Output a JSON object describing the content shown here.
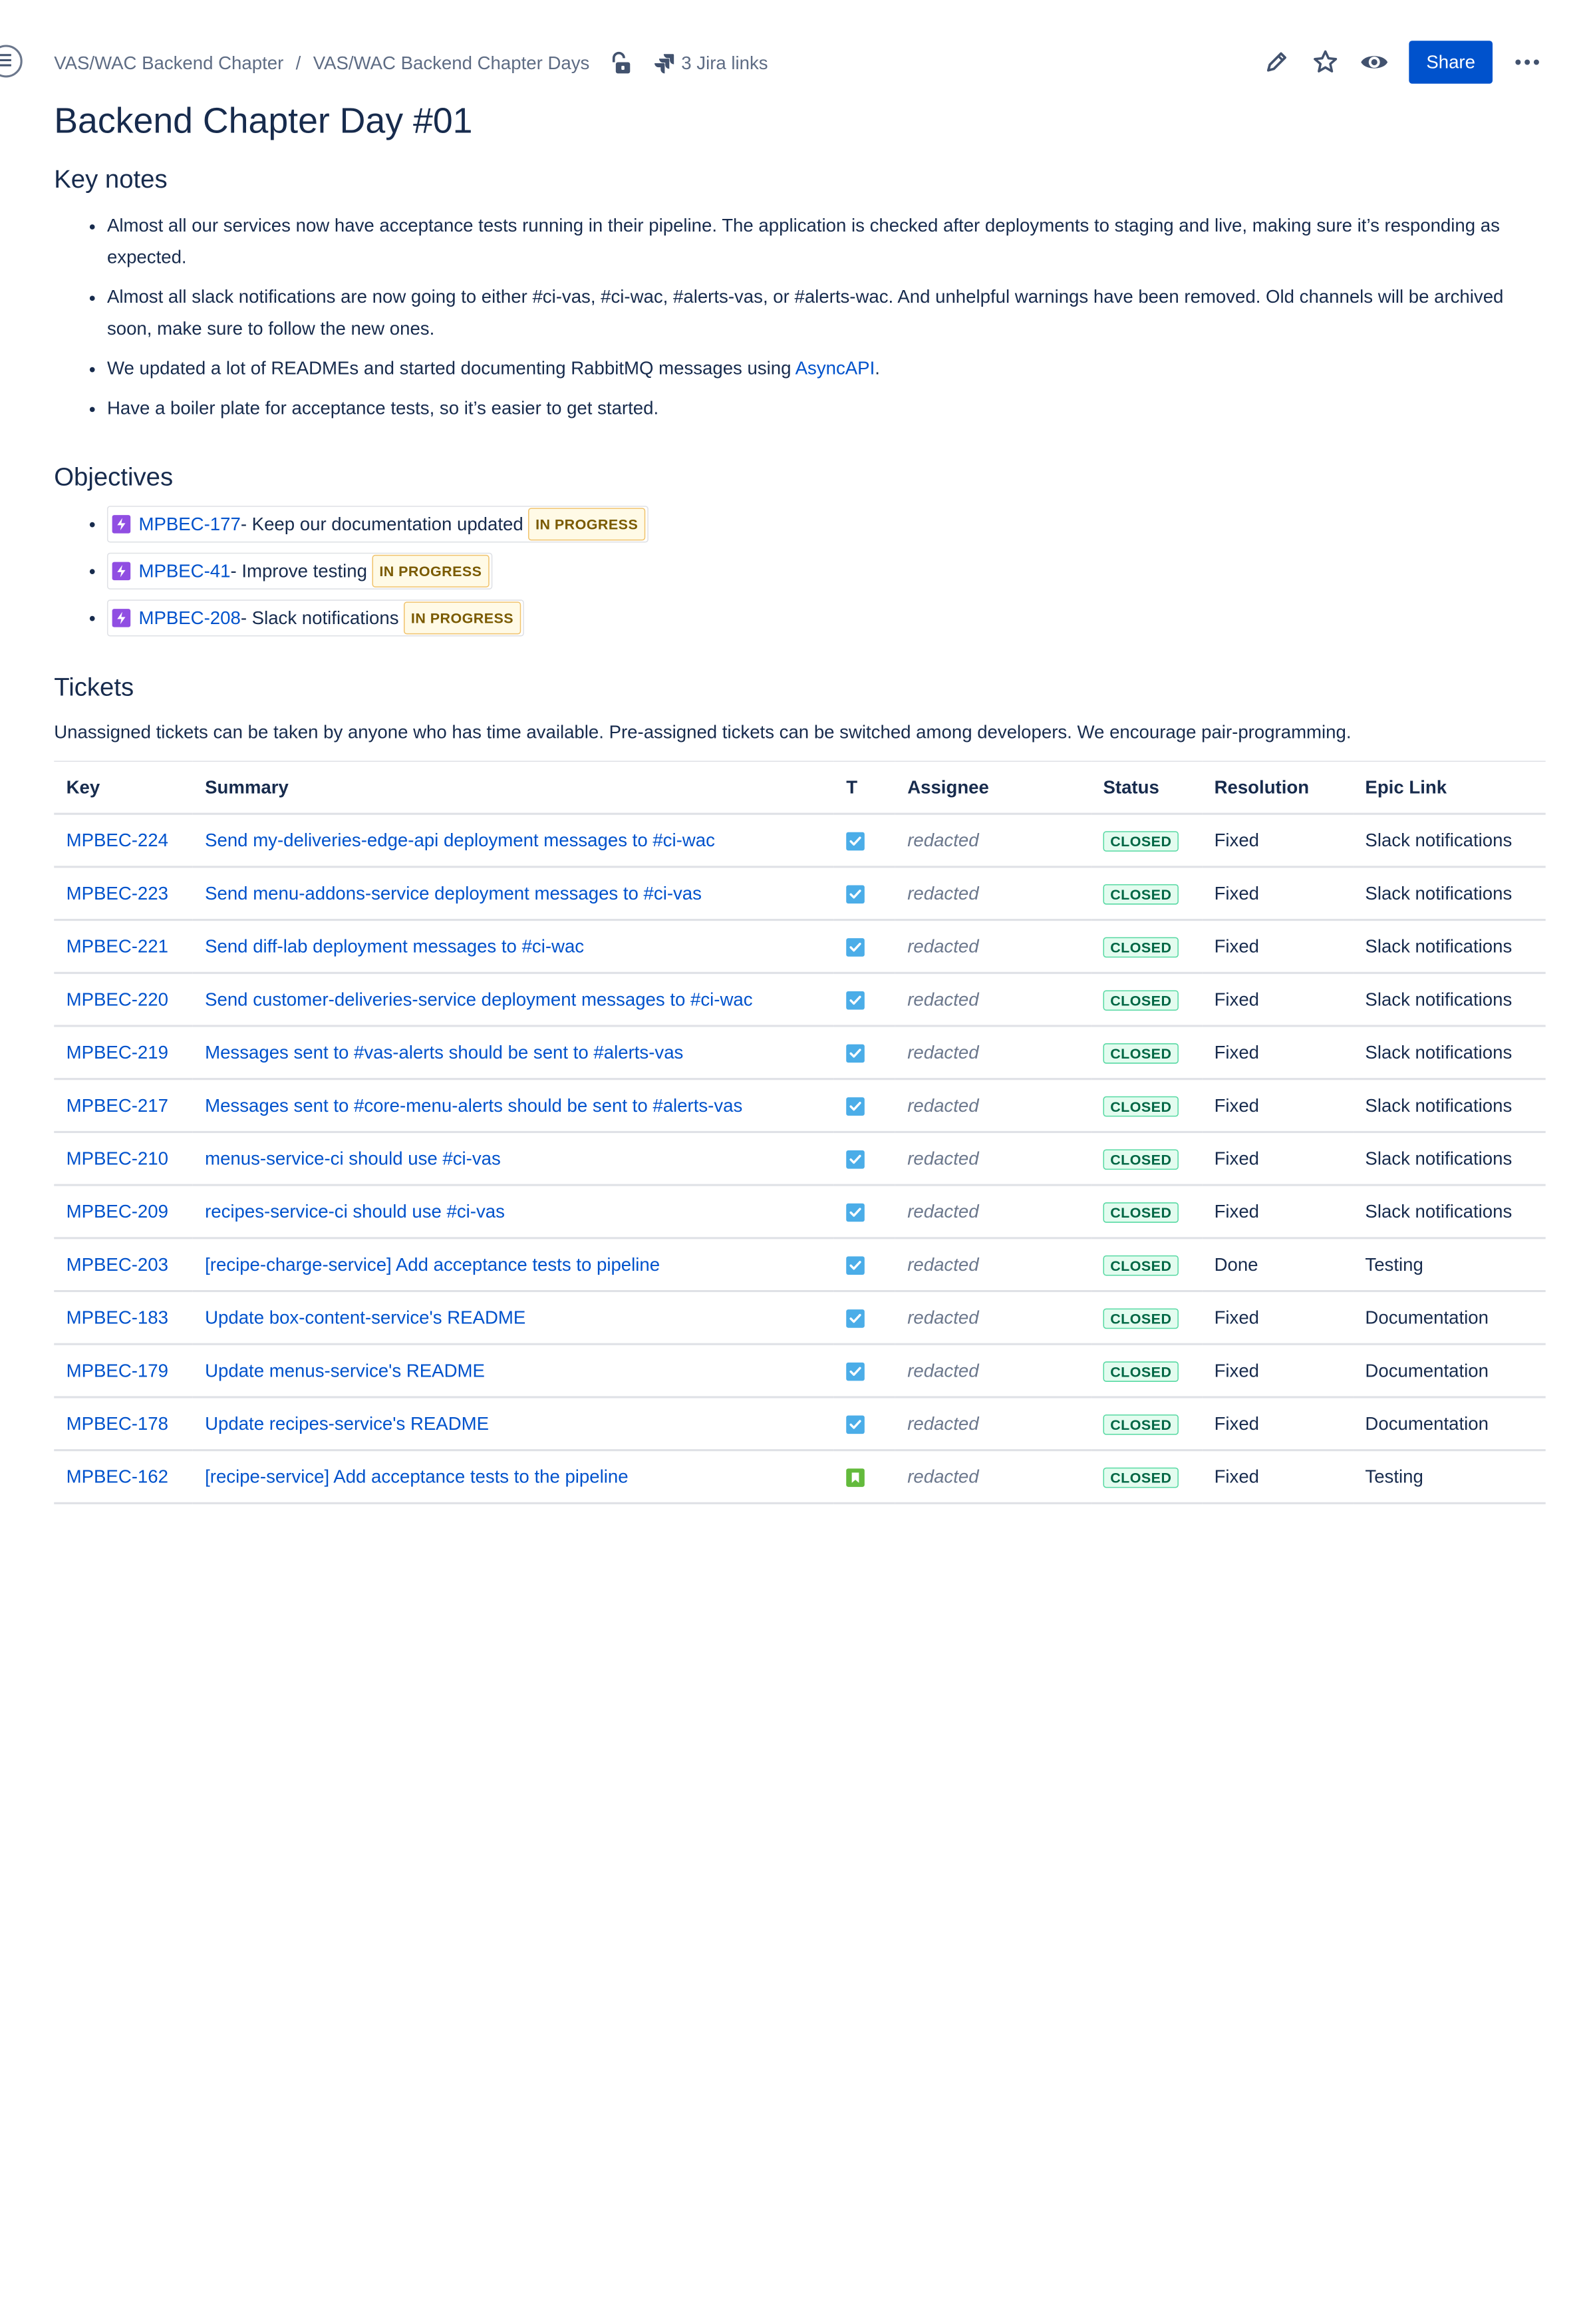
{
  "breadcrumbs": [
    "VAS/WAC Backend Chapter",
    "VAS/WAC Backend Chapter Days"
  ],
  "breadcrumb_separator": "/",
  "jira_links_label": "3 Jira links",
  "share_label": "Share",
  "title": "Backend Chapter Day #01",
  "key_notes": {
    "heading": "Key notes",
    "items": [
      "Almost all our services now have acceptance tests running in their pipeline. The application is checked after deployments to staging and live, making sure it’s responding as expected.",
      "Almost all slack notifications are now going to either #ci-vas, #ci-wac, #alerts-vas, or #alerts-wac. And unhelpful warnings have been removed. Old channels will be archived soon, make sure to follow the new ones.",
      "We updated a lot of READMEs and started documenting RabbitMQ messages using ",
      "Have a boiler plate for acceptance tests, so it’s easier to get started."
    ],
    "asyncapi_link": "AsyncAPI",
    "asyncapi_suffix": "."
  },
  "objectives": {
    "heading": "Objectives",
    "items": [
      {
        "key": "MPBEC-177",
        "summary": " - Keep our documentation updated",
        "status": "IN PROGRESS"
      },
      {
        "key": "MPBEC-41",
        "summary": " - Improve testing",
        "status": "IN PROGRESS"
      },
      {
        "key": "MPBEC-208",
        "summary": " - Slack notifications",
        "status": "IN PROGRESS"
      }
    ]
  },
  "tickets": {
    "heading": "Tickets",
    "intro": "Unassigned tickets can be taken by anyone who has time available. Pre-assigned tickets can be switched among developers. We encourage pair-programming.",
    "columns": {
      "key": "Key",
      "summary": "Summary",
      "type": "T",
      "assignee": "Assignee",
      "status": "Status",
      "resolution": "Resolution",
      "epic": "Epic Link"
    },
    "rows": [
      {
        "key": "MPBEC-224",
        "summary": "Send my-deliveries-edge-api deployment messages to #ci-wac",
        "type": "task",
        "assignee": "redacted",
        "status": "CLOSED",
        "resolution": "Fixed",
        "epic": "Slack notifications"
      },
      {
        "key": "MPBEC-223",
        "summary": "Send menu-addons-service deployment messages to #ci-vas",
        "type": "task",
        "assignee": "redacted",
        "status": "CLOSED",
        "resolution": "Fixed",
        "epic": "Slack notifications"
      },
      {
        "key": "MPBEC-221",
        "summary": "Send diff-lab deployment messages to #ci-wac",
        "type": "task",
        "assignee": "redacted",
        "status": "CLOSED",
        "resolution": "Fixed",
        "epic": "Slack notifications"
      },
      {
        "key": "MPBEC-220",
        "summary": "Send customer-deliveries-service deployment messages to #ci-wac",
        "type": "task",
        "assignee": "redacted",
        "status": "CLOSED",
        "resolution": "Fixed",
        "epic": "Slack notifications"
      },
      {
        "key": "MPBEC-219",
        "summary": "Messages sent to #vas-alerts should be sent to #alerts-vas",
        "type": "task",
        "assignee": "redacted",
        "status": "CLOSED",
        "resolution": "Fixed",
        "epic": "Slack notifications"
      },
      {
        "key": "MPBEC-217",
        "summary": "Messages sent to #core-menu-alerts should be sent to #alerts-vas",
        "type": "task",
        "assignee": "redacted",
        "status": "CLOSED",
        "resolution": "Fixed",
        "epic": "Slack notifications"
      },
      {
        "key": "MPBEC-210",
        "summary": "menus-service-ci should use #ci-vas",
        "type": "task",
        "assignee": "redacted",
        "status": "CLOSED",
        "resolution": "Fixed",
        "epic": "Slack notifications"
      },
      {
        "key": "MPBEC-209",
        "summary": "recipes-service-ci should use #ci-vas",
        "type": "task",
        "assignee": "redacted",
        "status": "CLOSED",
        "resolution": "Fixed",
        "epic": "Slack notifications"
      },
      {
        "key": "MPBEC-203",
        "summary": "[recipe-charge-service] Add acceptance tests to pipeline",
        "type": "task",
        "assignee": "redacted",
        "status": "CLOSED",
        "resolution": "Done",
        "epic": "Testing"
      },
      {
        "key": "MPBEC-183",
        "summary": "Update box-content-service's README",
        "type": "task",
        "assignee": "redacted",
        "status": "CLOSED",
        "resolution": "Fixed",
        "epic": "Documentation"
      },
      {
        "key": "MPBEC-179",
        "summary": "Update menus-service's README",
        "type": "task",
        "assignee": "redacted",
        "status": "CLOSED",
        "resolution": "Fixed",
        "epic": "Documentation"
      },
      {
        "key": "MPBEC-178",
        "summary": "Update recipes-service's README",
        "type": "task",
        "assignee": "redacted",
        "status": "CLOSED",
        "resolution": "Fixed",
        "epic": "Documentation"
      },
      {
        "key": "MPBEC-162",
        "summary": "[recipe-service] Add acceptance tests to the pipeline",
        "type": "story",
        "assignee": "redacted",
        "status": "CLOSED",
        "resolution": "Fixed",
        "epic": "Testing"
      }
    ]
  },
  "icons": {
    "sidebar_toggle": "menu-icon",
    "restrictions": "unlock-icon",
    "jira": "jira-icon",
    "edit": "pencil-icon",
    "star": "star-icon",
    "watch": "eye-icon",
    "more": "more-icon",
    "epic": "epic-icon",
    "task": "task-icon",
    "story": "story-icon"
  },
  "colors": {
    "link": "#0052cc",
    "primary_button": "#0052cc",
    "epic": "#904ee2",
    "task": "#4bade8",
    "story": "#63ba3c",
    "closed_text": "#006644",
    "in_progress_text": "#7a5a00"
  }
}
